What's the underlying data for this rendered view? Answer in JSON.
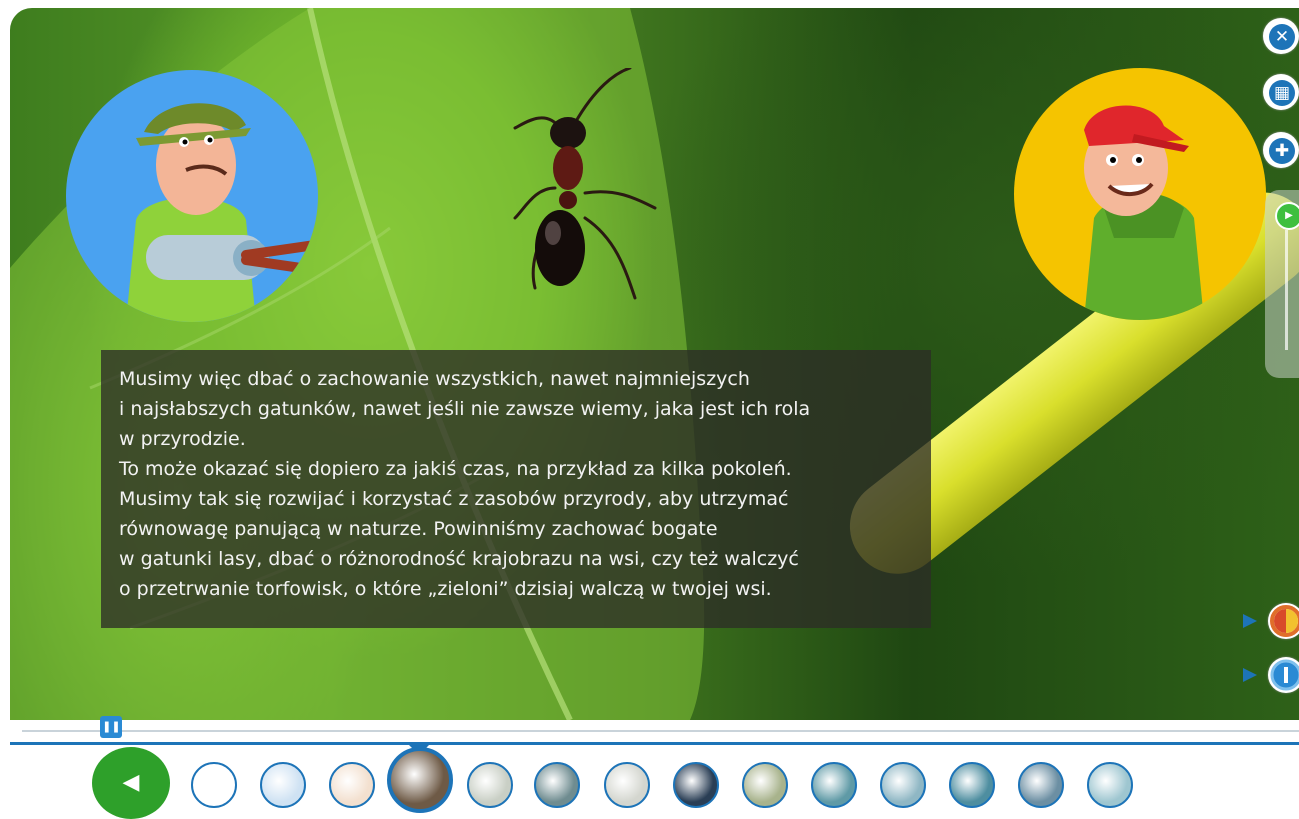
{
  "narration": {
    "text": "Musimy więc dbać o zachowanie wszystkich, nawet najmniejszych\ni najsłabszych gatunków, nawet jeśli nie zawsze wiemy, jaka jest ich rola\nw przyrodzie.\nTo może okazać się dopiero za jakiś czas, na przykład za kilka pokoleń.\nMusimy tak się rozwijać i korzystać z zasobów przyrody, aby utrzymać\nrównowagę panującą w naturze. Powinniśmy zachować bogate\nw gatunki lasy, dbać o różnorodność krajobrazu na wsi, czy też walczyć\no przetrwanie torfowisk, o które „zieloni” dzisiaj walczą w twojej wsi."
  },
  "side_controls": {
    "close_icon": "close-icon",
    "table_icon": "table-icon",
    "first_aid_icon": "first-aid-icon",
    "volume_icon": "volume-icon"
  },
  "playback": {
    "progress_fraction": 0.07,
    "paused": false,
    "handle_icon": "pause-icon"
  },
  "navigation": {
    "back_icon": "triangle-left-icon",
    "thumbnails": [
      {
        "name": "thumb-1",
        "color": "#ffffff",
        "active": false
      },
      {
        "name": "thumb-2",
        "color": "#cfe2f3",
        "active": false
      },
      {
        "name": "thumb-3",
        "color": "#f3e0cf",
        "active": false
      },
      {
        "name": "thumb-4",
        "color": "#6e5a46",
        "active": true
      },
      {
        "name": "thumb-5",
        "color": "#c9cfc5",
        "active": false
      },
      {
        "name": "thumb-6",
        "color": "#6f8c90",
        "active": false
      },
      {
        "name": "thumb-7",
        "color": "#d4d6cf",
        "active": false
      },
      {
        "name": "thumb-8",
        "color": "#2a3e55",
        "active": false
      },
      {
        "name": "thumb-9",
        "color": "#a8b38c",
        "active": false
      },
      {
        "name": "thumb-10",
        "color": "#5f9aa6",
        "active": false
      },
      {
        "name": "thumb-11",
        "color": "#8fb7c4",
        "active": false
      },
      {
        "name": "thumb-12",
        "color": "#4e8ea0",
        "active": false
      },
      {
        "name": "thumb-13",
        "color": "#6c8fa3",
        "active": false
      },
      {
        "name": "thumb-14",
        "color": "#9ec6d0",
        "active": false
      }
    ]
  },
  "colors": {
    "accent": "#1d74b8",
    "back_button": "#2ea02a",
    "left_avatar_bg": "#4aa2f0",
    "right_avatar_bg": "#f5c400"
  }
}
